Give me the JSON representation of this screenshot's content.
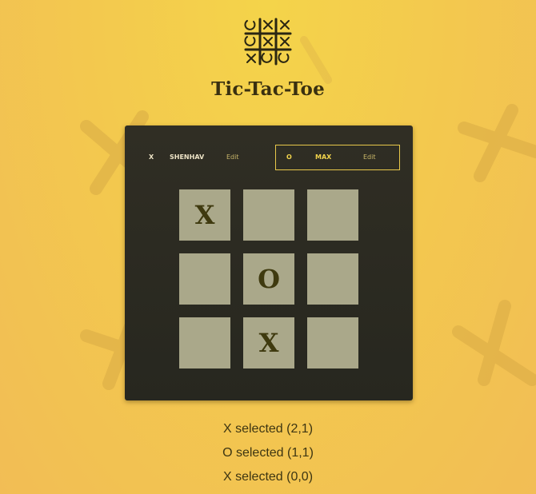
{
  "header": {
    "title": "Tic-Tac-Toe"
  },
  "players": [
    {
      "symbol": "X",
      "name": "SHENHAV",
      "edit_label": "Edit",
      "active": false
    },
    {
      "symbol": "O",
      "name": "MAX",
      "edit_label": "Edit",
      "active": true
    }
  ],
  "board": {
    "cells": [
      [
        "X",
        "",
        ""
      ],
      [
        "",
        "O",
        ""
      ],
      [
        "",
        "X",
        ""
      ]
    ]
  },
  "log": [
    "X selected (2,1)",
    "O selected (1,1)",
    "X selected (0,0)"
  ],
  "colors": {
    "background": "#f3c94e",
    "panel": "#2d2c22",
    "cell": "#aaa88a",
    "mark": "#3f3a0f",
    "active_accent": "#f1d34c"
  },
  "icons": {
    "logo": "tic-tac-toe-logo-icon",
    "background": "scribbled-x-mark-icon"
  }
}
